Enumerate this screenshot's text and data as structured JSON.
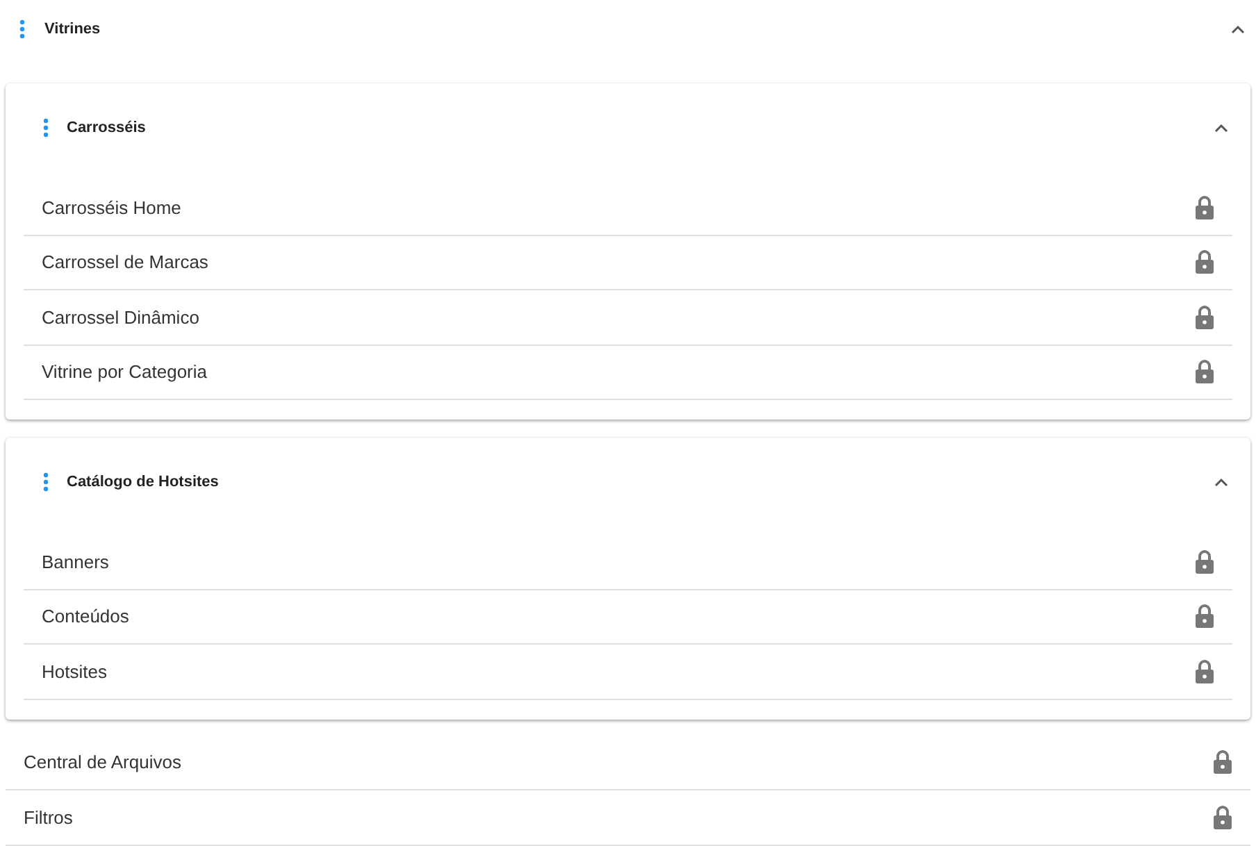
{
  "section": {
    "title": "Vitrines",
    "expanded": true
  },
  "groups": [
    {
      "title": "Carrosséis",
      "expanded": true,
      "items": [
        {
          "label": "Carrosséis Home",
          "locked": true
        },
        {
          "label": "Carrossel de Marcas",
          "locked": true
        },
        {
          "label": "Carrossel Dinâmico",
          "locked": true
        },
        {
          "label": "Vitrine por Categoria",
          "locked": true
        }
      ]
    },
    {
      "title": "Catálogo de Hotsites",
      "expanded": true,
      "items": [
        {
          "label": "Banners",
          "locked": true
        },
        {
          "label": "Conteúdos",
          "locked": true
        },
        {
          "label": "Hotsites",
          "locked": true
        }
      ]
    }
  ],
  "items": [
    {
      "label": "Central de Arquivos",
      "locked": true
    },
    {
      "label": "Filtros",
      "locked": true
    }
  ]
}
